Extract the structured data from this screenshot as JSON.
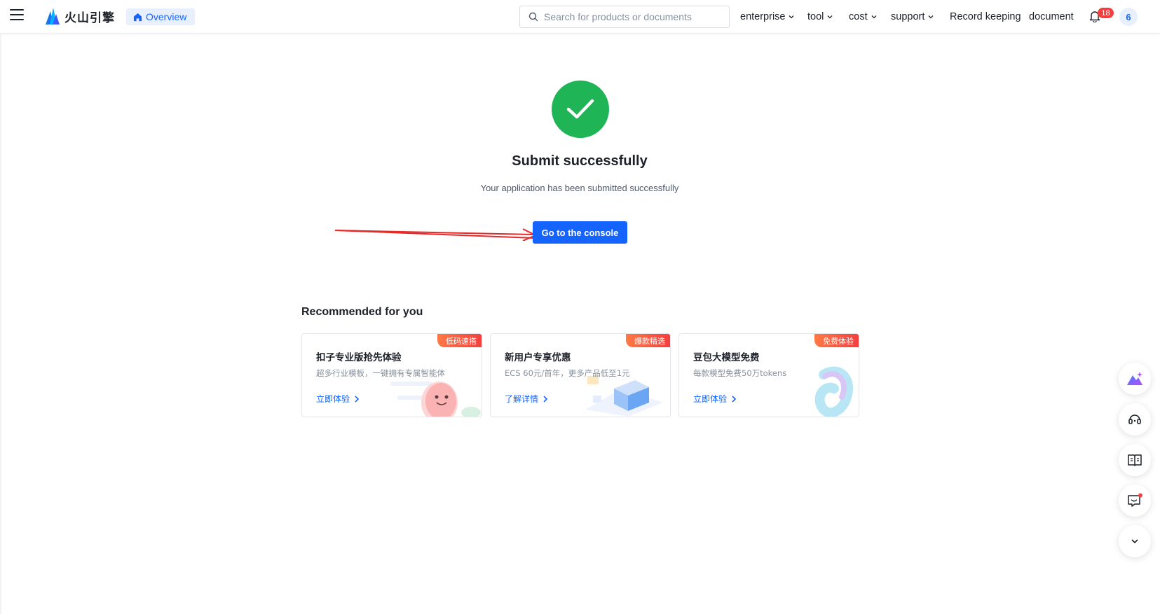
{
  "header": {
    "logo_text": "火山引擎",
    "overview_tab": "Overview",
    "search_placeholder": "Search for products or documents",
    "nav": {
      "enterprise": "enterprise",
      "tool": "tool",
      "cost": "cost",
      "support": "support",
      "record_keeping": "Record keeping",
      "document": "document"
    },
    "notification_count": "18",
    "avatar_label": "6"
  },
  "result": {
    "title": "Submit successfully",
    "subtitle": "Your application has been submitted successfully",
    "button_label": "Go to the console"
  },
  "recommended": {
    "title": "Recommended for you",
    "cards": [
      {
        "tag": "低码速搭",
        "title": "扣子专业版抢先体验",
        "desc": "超多行业模板，一键拥有专属智能体",
        "link": "立即体验"
      },
      {
        "tag": "爆款精选",
        "title": "新用户专享优惠",
        "desc": "ECS 60元/首年，更多产品低至1元",
        "link": "了解详情"
      },
      {
        "tag": "免费体验",
        "title": "豆包大模型免费",
        "desc": "每款模型免费50万tokens",
        "link": "立即体验"
      }
    ]
  },
  "colors": {
    "primary": "#1664ff",
    "success": "#1fb456",
    "badge": "#f53f3f",
    "annotation_arrow": "#e52a2a"
  }
}
